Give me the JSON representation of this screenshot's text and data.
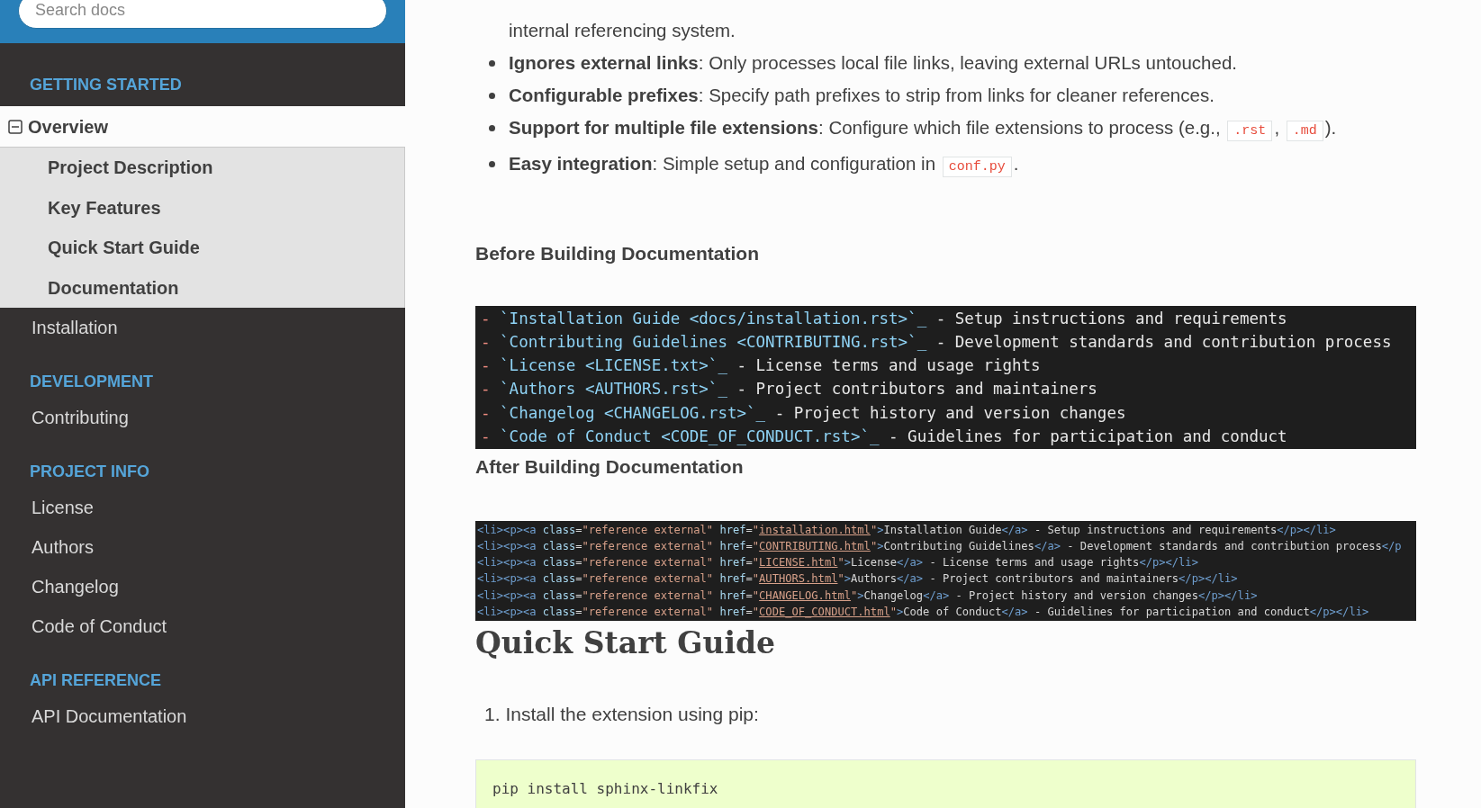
{
  "sidebar": {
    "search": {
      "placeholder": "Search docs"
    },
    "sections": [
      {
        "caption": "GETTING STARTED",
        "items": [
          {
            "label": "Overview",
            "current": true,
            "expanded": true,
            "children": [
              {
                "label": "Project Description"
              },
              {
                "label": "Key Features"
              },
              {
                "label": "Quick Start Guide"
              },
              {
                "label": "Documentation"
              }
            ]
          },
          {
            "label": "Installation",
            "current": false
          }
        ]
      },
      {
        "caption": "DEVELOPMENT",
        "items": [
          {
            "label": "Contributing",
            "current": false
          }
        ]
      },
      {
        "caption": "PROJECT INFO",
        "items": [
          {
            "label": "License",
            "current": false
          },
          {
            "label": "Authors",
            "current": false
          },
          {
            "label": "Changelog",
            "current": false
          },
          {
            "label": "Code of Conduct",
            "current": false
          }
        ]
      },
      {
        "caption": "API REFERENCE",
        "items": [
          {
            "label": "API Documentation",
            "current": false
          }
        ]
      }
    ]
  },
  "content": {
    "features": [
      {
        "kind": "continuation",
        "parts": [
          {
            "kind": "text",
            "text": "internal referencing system."
          }
        ]
      },
      {
        "kind": "bullet",
        "term": "Ignores external links",
        "parts": [
          {
            "kind": "text",
            "text": ": Only processes local file links, leaving external URLs untouched."
          }
        ]
      },
      {
        "kind": "bullet",
        "term": "Configurable prefixes",
        "parts": [
          {
            "kind": "text",
            "text": ": Specify path prefixes to strip from links for cleaner references."
          }
        ]
      },
      {
        "kind": "bullet",
        "term": "Support for multiple file extensions",
        "parts": [
          {
            "kind": "text",
            "text": ": Configure which file extensions to process (e.g., "
          },
          {
            "kind": "code",
            "text": ".rst"
          },
          {
            "kind": "text",
            "text": ", "
          },
          {
            "kind": "code",
            "text": ".md"
          },
          {
            "kind": "text",
            "text": ")."
          }
        ]
      },
      {
        "kind": "bullet",
        "term": "Easy integration",
        "parts": [
          {
            "kind": "text",
            "text": ": Simple setup and configuration in "
          },
          {
            "kind": "code",
            "text": "conf.py"
          },
          {
            "kind": "text",
            "text": "."
          }
        ]
      }
    ],
    "before_heading": "Before Building Documentation",
    "rst_lines": [
      [
        {
          "kind": "dash",
          "text": "- "
        },
        {
          "kind": "link",
          "text": "`Installation Guide <docs/installation.rst>`_"
        },
        {
          "kind": "text",
          "text": " - Setup instructions and requirements"
        }
      ],
      [
        {
          "kind": "dash",
          "text": "- "
        },
        {
          "kind": "link",
          "text": "`Contributing Guidelines <CONTRIBUTING.rst>`_"
        },
        {
          "kind": "text",
          "text": " - Development standards and contribution process"
        }
      ],
      [
        {
          "kind": "dash",
          "text": "- "
        },
        {
          "kind": "link",
          "text": "`License <LICENSE.txt>`_"
        },
        {
          "kind": "text",
          "text": " - License terms and usage rights"
        }
      ],
      [
        {
          "kind": "dash",
          "text": "- "
        },
        {
          "kind": "link",
          "text": "`Authors <AUTHORS.rst>`_"
        },
        {
          "kind": "text",
          "text": " - Project contributors and maintainers"
        }
      ],
      [
        {
          "kind": "dash",
          "text": "- "
        },
        {
          "kind": "link",
          "text": "`Changelog <CHANGELOG.rst>`_"
        },
        {
          "kind": "text",
          "text": " - Project history and version changes"
        }
      ],
      [
        {
          "kind": "dash",
          "text": "- "
        },
        {
          "kind": "link",
          "text": "`Code of Conduct <CODE_OF_CONDUCT.rst>`_"
        },
        {
          "kind": "text",
          "text": " - Guidelines for participation and conduct"
        }
      ]
    ],
    "after_heading": "After Building Documentation",
    "html_lines": [
      [
        {
          "kind": "tag",
          "text": "<li><p><a"
        },
        {
          "kind": "attr",
          "text": " class"
        },
        {
          "kind": "text",
          "text": "="
        },
        {
          "kind": "string",
          "text": "\"reference external\""
        },
        {
          "kind": "attr",
          "text": " href"
        },
        {
          "kind": "text",
          "text": "="
        },
        {
          "kind": "string",
          "text": "\""
        },
        {
          "kind": "url",
          "text": "installation.html"
        },
        {
          "kind": "string",
          "text": "\""
        },
        {
          "kind": "tag",
          "text": ">"
        },
        {
          "kind": "text",
          "text": "Installation Guide"
        },
        {
          "kind": "tag",
          "text": "</a>"
        },
        {
          "kind": "text",
          "text": " - Setup instructions and requirements"
        },
        {
          "kind": "tag",
          "text": "</p></li>"
        }
      ],
      [
        {
          "kind": "tag",
          "text": "<li><p><a"
        },
        {
          "kind": "attr",
          "text": " class"
        },
        {
          "kind": "text",
          "text": "="
        },
        {
          "kind": "string",
          "text": "\"reference external\""
        },
        {
          "kind": "attr",
          "text": " href"
        },
        {
          "kind": "text",
          "text": "="
        },
        {
          "kind": "string",
          "text": "\""
        },
        {
          "kind": "url",
          "text": "CONTRIBUTING.html"
        },
        {
          "kind": "string",
          "text": "\""
        },
        {
          "kind": "tag",
          "text": ">"
        },
        {
          "kind": "text",
          "text": "Contributing Guidelines"
        },
        {
          "kind": "tag",
          "text": "</a>"
        },
        {
          "kind": "text",
          "text": " - Development standards and contribution process"
        },
        {
          "kind": "tag",
          "text": "</p"
        }
      ],
      [
        {
          "kind": "tag",
          "text": "<li><p><a"
        },
        {
          "kind": "attr",
          "text": " class"
        },
        {
          "kind": "text",
          "text": "="
        },
        {
          "kind": "string",
          "text": "\"reference external\""
        },
        {
          "kind": "attr",
          "text": " href"
        },
        {
          "kind": "text",
          "text": "="
        },
        {
          "kind": "string",
          "text": "\""
        },
        {
          "kind": "url",
          "text": "LICENSE.html"
        },
        {
          "kind": "string",
          "text": "\""
        },
        {
          "kind": "tag",
          "text": ">"
        },
        {
          "kind": "text",
          "text": "License"
        },
        {
          "kind": "tag",
          "text": "</a>"
        },
        {
          "kind": "text",
          "text": " - License terms and usage rights"
        },
        {
          "kind": "tag",
          "text": "</p></li>"
        }
      ],
      [
        {
          "kind": "tag",
          "text": "<li><p><a"
        },
        {
          "kind": "attr",
          "text": " class"
        },
        {
          "kind": "text",
          "text": "="
        },
        {
          "kind": "string",
          "text": "\"reference external\""
        },
        {
          "kind": "attr",
          "text": " href"
        },
        {
          "kind": "text",
          "text": "="
        },
        {
          "kind": "string",
          "text": "\""
        },
        {
          "kind": "url",
          "text": "AUTHORS.html"
        },
        {
          "kind": "string",
          "text": "\""
        },
        {
          "kind": "tag",
          "text": ">"
        },
        {
          "kind": "text",
          "text": "Authors"
        },
        {
          "kind": "tag",
          "text": "</a>"
        },
        {
          "kind": "text",
          "text": " - Project contributors and maintainers"
        },
        {
          "kind": "tag",
          "text": "</p></li>"
        }
      ],
      [
        {
          "kind": "tag",
          "text": "<li><p><a"
        },
        {
          "kind": "attr",
          "text": " class"
        },
        {
          "kind": "text",
          "text": "="
        },
        {
          "kind": "string",
          "text": "\"reference external\""
        },
        {
          "kind": "attr",
          "text": " href"
        },
        {
          "kind": "text",
          "text": "="
        },
        {
          "kind": "string",
          "text": "\""
        },
        {
          "kind": "url",
          "text": "CHANGELOG.html"
        },
        {
          "kind": "string",
          "text": "\""
        },
        {
          "kind": "tag",
          "text": ">"
        },
        {
          "kind": "text",
          "text": "Changelog"
        },
        {
          "kind": "tag",
          "text": "</a>"
        },
        {
          "kind": "text",
          "text": " - Project history and version changes"
        },
        {
          "kind": "tag",
          "text": "</p></li>"
        }
      ],
      [
        {
          "kind": "tag",
          "text": "<li><p><a"
        },
        {
          "kind": "attr",
          "text": " class"
        },
        {
          "kind": "text",
          "text": "="
        },
        {
          "kind": "string",
          "text": "\"reference external\""
        },
        {
          "kind": "attr",
          "text": " href"
        },
        {
          "kind": "text",
          "text": "="
        },
        {
          "kind": "string",
          "text": "\""
        },
        {
          "kind": "url",
          "text": "CODE_OF_CONDUCT.html"
        },
        {
          "kind": "string",
          "text": "\""
        },
        {
          "kind": "tag",
          "text": ">"
        },
        {
          "kind": "text",
          "text": "Code of Conduct"
        },
        {
          "kind": "tag",
          "text": "</a>"
        },
        {
          "kind": "text",
          "text": " - Guidelines for participation and conduct"
        },
        {
          "kind": "tag",
          "text": "</p></li>"
        }
      ]
    ],
    "quick_start": {
      "title": "Quick Start Guide",
      "steps": [
        {
          "number": "1.",
          "text": "Install the extension using pip:"
        }
      ],
      "command": "pip install sphinx-linkfix"
    }
  }
}
